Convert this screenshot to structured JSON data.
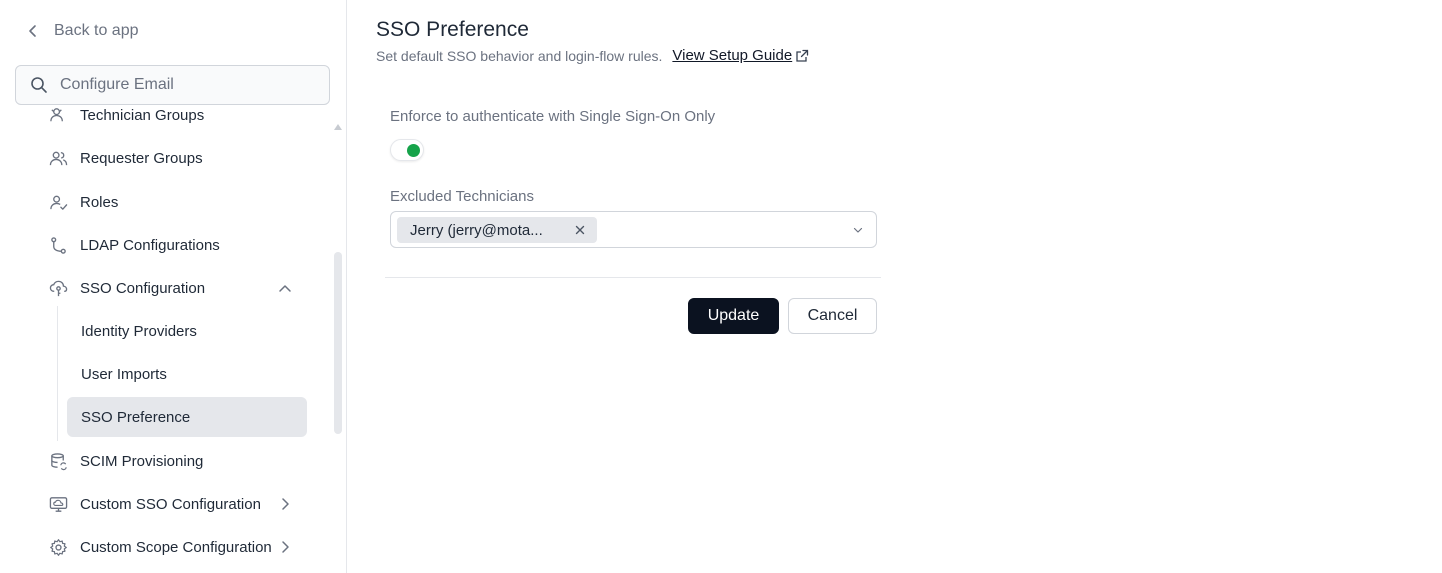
{
  "sidebar": {
    "back_label": "Back to app",
    "search": {
      "placeholder": "Configure Email",
      "value": ""
    },
    "partial_item": {
      "label": "Technician Groups",
      "icon": "users-gear-icon"
    },
    "items": [
      {
        "label": "Requester Groups",
        "icon": "users-icon"
      },
      {
        "label": "Roles",
        "icon": "user-check-icon"
      },
      {
        "label": "LDAP Configurations",
        "icon": "git-branch-icon"
      },
      {
        "label": "SSO Configuration",
        "icon": "cloud-key-icon",
        "expanded": true
      },
      {
        "label": "SCIM Provisioning",
        "icon": "database-sync-icon"
      },
      {
        "label": "Custom SSO Configuration",
        "icon": "monitor-cloud-icon"
      },
      {
        "label": "Custom Scope Configuration",
        "icon": "gear-icon"
      }
    ],
    "sso_subitems": [
      {
        "label": "Identity Providers",
        "active": false
      },
      {
        "label": "User Imports",
        "active": false
      },
      {
        "label": "SSO Preference",
        "active": true
      }
    ]
  },
  "main": {
    "title": "SSO Preference",
    "description": "Set default SSO behavior and login-flow rules.",
    "guide_link": "View Setup Guide",
    "enforce_label": "Enforce to authenticate with Single Sign-On Only",
    "enforce_enabled": true,
    "excluded_label": "Excluded Technicians",
    "excluded_tags": [
      "Jerry (jerry@mota..."
    ],
    "update_label": "Update",
    "cancel_label": "Cancel"
  },
  "colors": {
    "accent_green": "#16a34a",
    "primary_button": "#0b1220",
    "active_item_bg": "#e5e7eb"
  }
}
